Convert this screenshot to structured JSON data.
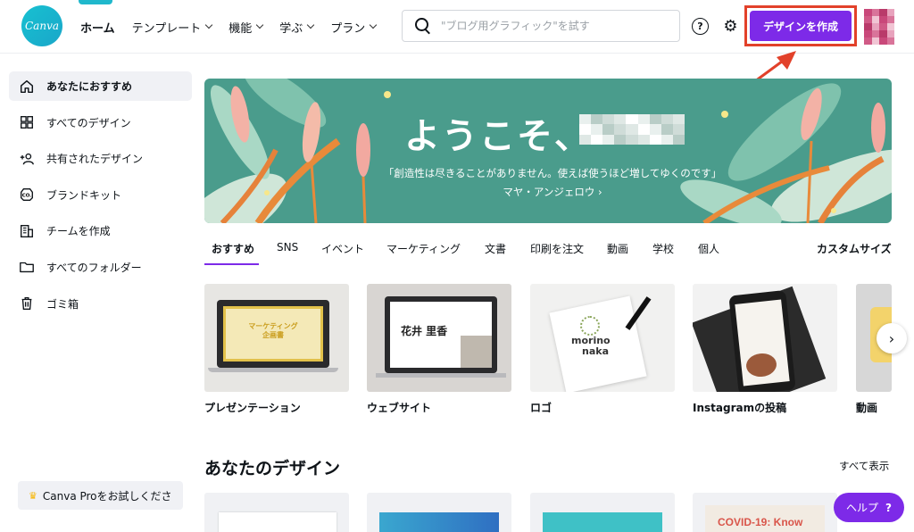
{
  "brand": {
    "logo_text": "Canva",
    "accent": "#7d2ae8",
    "highlight": "#e2412a"
  },
  "nav": {
    "items": [
      {
        "label": "ホーム",
        "dropdown": false
      },
      {
        "label": "テンプレート",
        "dropdown": true
      },
      {
        "label": "機能",
        "dropdown": true
      },
      {
        "label": "学ぶ",
        "dropdown": true
      },
      {
        "label": "プラン",
        "dropdown": true
      }
    ]
  },
  "search": {
    "placeholder": "\"ブログ用グラフィック\"を試す",
    "value": ""
  },
  "header": {
    "help_glyph": "?",
    "settings_icon": "gear-icon",
    "create_button": "デザインを作成"
  },
  "sidebar": {
    "items": [
      {
        "label": "あなたにおすすめ",
        "icon": "home-icon",
        "active": true
      },
      {
        "label": "すべてのデザイン",
        "icon": "grid-icon",
        "active": false
      },
      {
        "label": "共有されたデザイン",
        "icon": "shared-users-icon",
        "active": false
      },
      {
        "label": "ブランドキット",
        "icon": "brand-kit-icon",
        "active": false
      },
      {
        "label": "チームを作成",
        "icon": "team-building-icon",
        "active": false
      },
      {
        "label": "すべてのフォルダー",
        "icon": "folder-icon",
        "active": false
      },
      {
        "label": "ゴミ箱",
        "icon": "trash-icon",
        "active": false
      }
    ],
    "pro_button": "Canva Proをお試しくださ"
  },
  "banner": {
    "welcome": "ようこそ、",
    "quote": "「創造性は尽きることがありません。使えば使うほど増してゆくのです」マヤ・アンジェロウ ›"
  },
  "categories": {
    "tabs": [
      "おすすめ",
      "SNS",
      "イベント",
      "マーケティング",
      "文書",
      "印刷を注文",
      "動画",
      "学校",
      "個人"
    ],
    "active": 0,
    "custom_size": "カスタムサイズ"
  },
  "cards": [
    {
      "label": "プレゼンテーション",
      "thumb_text": [
        "マーケティング",
        "企画書"
      ]
    },
    {
      "label": "ウェブサイト",
      "thumb_text": [
        "花井 里香"
      ]
    },
    {
      "label": "ロゴ",
      "thumb_text": [
        "morino",
        "naka"
      ]
    },
    {
      "label": "Instagramの投稿",
      "thumb_text": []
    },
    {
      "label": "動画",
      "thumb_text": []
    }
  ],
  "your_designs": {
    "title": "あなたのデザイン",
    "view_all": "すべて表示",
    "thumbs": [
      {
        "text": ""
      },
      {
        "text": ""
      },
      {
        "text": ""
      },
      {
        "text": "COVID-19: Know"
      }
    ]
  },
  "help_button": {
    "label": "ヘルプ",
    "glyph": "?"
  }
}
